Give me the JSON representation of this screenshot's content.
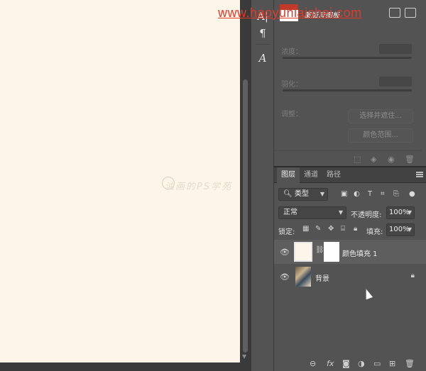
{
  "watermark": {
    "url": "www.haoyunlaishei.com",
    "canvas_text": "油画的PS学苑"
  },
  "tools": [
    {
      "icon": "text-vertical-icon",
      "glyph": "A|"
    },
    {
      "icon": "paragraph-icon",
      "glyph": "¶"
    },
    {
      "icon": "glyph-icon",
      "glyph": "A"
    }
  ],
  "properties": {
    "title": "蒙版异图板",
    "density_label": "浓度：",
    "feather_label": "羽化：",
    "adjust_label": "调整：",
    "select_mask_button": "选择并遮住...",
    "color_range_button": "颜色范围..."
  },
  "layers_panel": {
    "tabs": [
      {
        "label": "图层",
        "active": true
      },
      {
        "label": "通道",
        "active": false
      },
      {
        "label": "路径",
        "active": false
      }
    ],
    "filter_kind": "类型",
    "blend_mode": "正常",
    "opacity_label": "不透明度:",
    "opacity_value": "100%",
    "lock_label": "锁定:",
    "fill_label": "填充:",
    "fill_value": "100%",
    "layers": [
      {
        "name": "颜色填充 1",
        "selected": true,
        "visible": true,
        "locked": false,
        "fill_color": "#fdf6e8"
      },
      {
        "name": "背景",
        "selected": false,
        "visible": true,
        "locked": true
      }
    ]
  },
  "colors": {
    "canvas": "#fdf6e8",
    "panel": "#535353",
    "accent_red": "#c0392b"
  }
}
